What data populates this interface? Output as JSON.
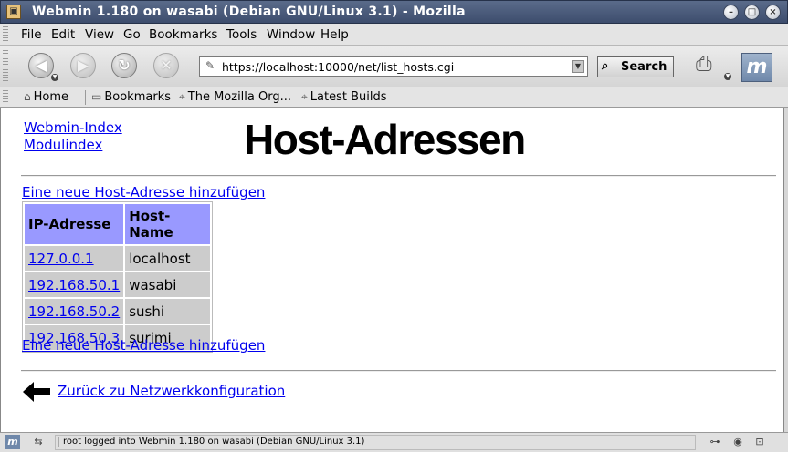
{
  "window": {
    "title": "Webmin 1.180 on wasabi (Debian GNU/Linux 3.1) - Mozilla",
    "app_icon": "mozilla-app-icon",
    "buttons": [
      "minimize-icon",
      "maximize-icon",
      "close-icon"
    ]
  },
  "menubar": {
    "items": [
      {
        "label": "File"
      },
      {
        "label": "Edit"
      },
      {
        "label": "View"
      },
      {
        "label": "Go"
      },
      {
        "label": "Bookmarks"
      },
      {
        "label": "Tools"
      },
      {
        "label": "Window"
      },
      {
        "label": "Help"
      }
    ]
  },
  "navbar": {
    "url": "https://localhost:10000/net/list_hosts.cgi",
    "search_label": "Search",
    "icons": [
      "back-icon",
      "forward-icon",
      "reload-icon",
      "stop-icon",
      "print-icon",
      "mozilla-logo-icon"
    ]
  },
  "personal_toolbar": {
    "home": "Home",
    "bookmarks": "Bookmarks",
    "links": [
      "The Mozilla Org...",
      "Latest Builds"
    ]
  },
  "page": {
    "nav_links": [
      "Webmin-Index",
      "Modulindex"
    ],
    "title": "Host-Adressen",
    "add_link": "Eine neue Host-Adresse hinzufügen",
    "table": {
      "headers": [
        "IP-Adresse",
        "Host-Name"
      ],
      "rows": [
        {
          "ip": "127.0.0.1",
          "name": "localhost"
        },
        {
          "ip": "192.168.50.1",
          "name": "wasabi"
        },
        {
          "ip": "192.168.50.2",
          "name": "sushi"
        },
        {
          "ip": "192.168.50.3",
          "name": "surimi"
        }
      ],
      "header_color": "#9999ff",
      "cell_color": "#cccccc"
    },
    "back_link": "Zurück zu Netzwerkkonfiguration"
  },
  "statusbar": {
    "text": "root logged into Webmin 1.180 on wasabi (Debian GNU/Linux 3.1)",
    "icons": [
      "mozilla-status-icon",
      "offline-icon",
      "connection-icon",
      "cookie-icon",
      "lock-icon"
    ]
  }
}
